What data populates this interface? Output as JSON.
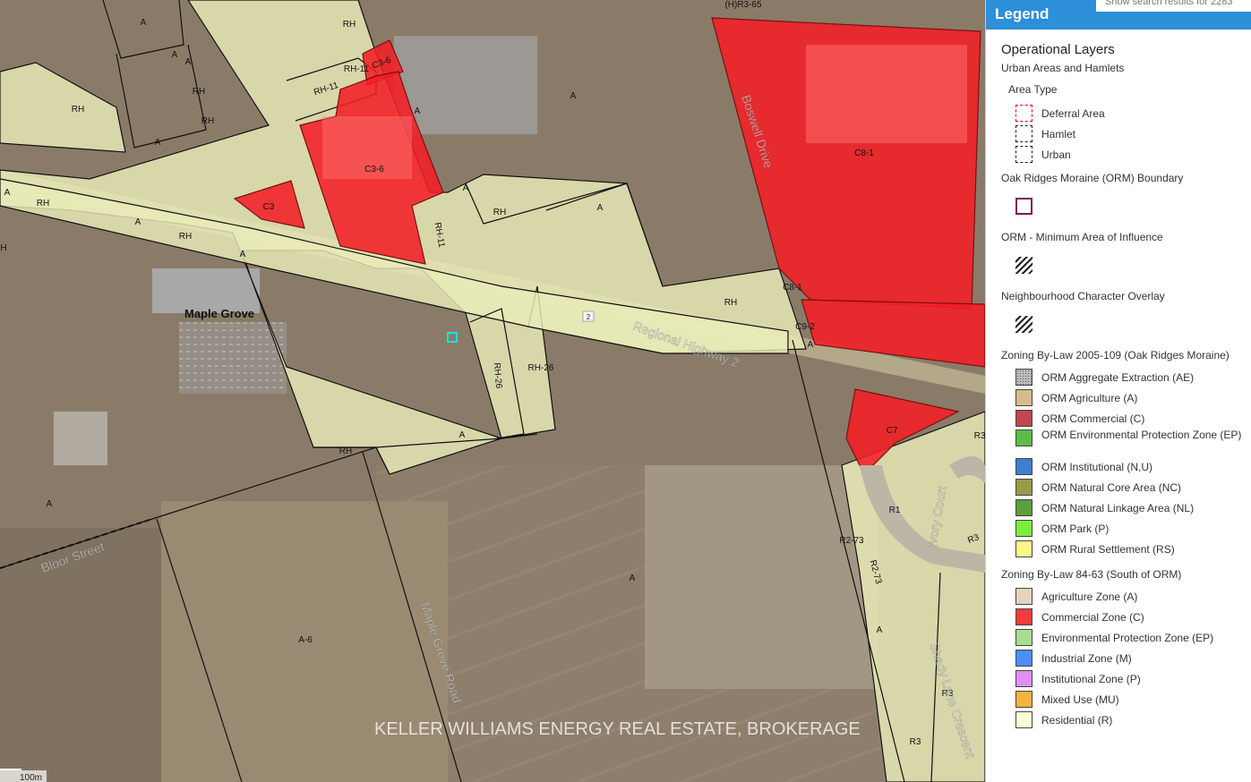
{
  "map": {
    "place_label": "Maple Grove",
    "streets": {
      "highway": "Regional Highway 2",
      "bloor": "Bloor Street",
      "maple_grove_road": "Maple Grove Road",
      "boswell": "Boswell Drive",
      "ivory": "Ivory Court",
      "shady_lane": "Shady Lane Crescent",
      "route_shield": "2"
    },
    "zone_labels": {
      "a_top_left": "A",
      "a_top_left2": "A",
      "a_top_left3": "A",
      "rh_top": "RH",
      "rh_left": "RH",
      "rh_left2": "RH",
      "rh_left3": "RH",
      "rh_11_a": "RH-11",
      "rh_11_b": "RH-11",
      "rh_11_c": "RH-11",
      "c3_6_top": "C3-6",
      "c3_6": "C3-6",
      "c3": "C3",
      "a_center": "A",
      "a_right": "A",
      "rh_right": "RH",
      "rh_mid": "RH",
      "a_small": "A",
      "rh_small": "RH",
      "rh_26": "RH-26",
      "rh_bot": "RH",
      "a_bot": "A",
      "a_left": "A",
      "a_left2": "A",
      "a_left3": "A",
      "a_field": "A",
      "a6": "A-6",
      "h": "H",
      "c8_1": "C8-1",
      "c8_1b": "C8-1",
      "c9_2": "C9-2",
      "a_corner": "A",
      "c7": "C7",
      "r1": "R1",
      "r3a": "R3",
      "r3b": "R3",
      "r3c": "R3",
      "r3d": "R3",
      "r2_73a": "R2-73",
      "r2_73b": "R2-73",
      "a_line": "A",
      "h_r3_65": "(H)R3-65"
    },
    "scale": "100m",
    "watermark": "KELLER WILLIAMS ENERGY REAL ESTATE, BROKERAGE"
  },
  "legend": {
    "title": "Legend",
    "search_hint": "Show search results for 2283",
    "operational_layers": "Operational Layers",
    "urban_areas": "Urban Areas and Hamlets",
    "area_type": "Area Type",
    "area_types": [
      "Deferral Area",
      "Hamlet",
      "Urban"
    ],
    "orm_boundary": "Oak Ridges Moraine (ORM) Boundary",
    "orm_min": "ORM - Minimum Area of Influence",
    "neighbourhood": "Neighbourhood Character Overlay",
    "zoning_orm": "Zoning By-Law 2005-109 (Oak Ridges Moraine)",
    "orm_items": [
      {
        "label": "ORM Aggregate Extraction (AE)",
        "color": "#9a9a9a"
      },
      {
        "label": "ORM Agriculture (A)",
        "color": "#d7b98c"
      },
      {
        "label": "ORM Commercial (C)",
        "color": "#c0474b"
      },
      {
        "label": "ORM Environmental Protection Zone (EP)",
        "color": "#5bbd45"
      },
      {
        "label": "ORM Institutional (N,U)",
        "color": "#3c7fcf"
      },
      {
        "label": "ORM Natural Core Area (NC)",
        "color": "#9a9a48"
      },
      {
        "label": "ORM Natural Linkage Area (NL)",
        "color": "#5c9f3c"
      },
      {
        "label": "ORM Park (P)",
        "color": "#7aef3a"
      },
      {
        "label": "ORM Rural Settlement (RS)",
        "color": "#f7f78a"
      }
    ],
    "zoning_south": "Zoning By-Law 84-63 (South of ORM)",
    "south_items": [
      {
        "label": "Agriculture Zone (A)",
        "color": "#e4d4c2"
      },
      {
        "label": "Commercial Zone (C)",
        "color": "#f23b3b"
      },
      {
        "label": "Environmental Protection Zone (EP)",
        "color": "#a9dd92"
      },
      {
        "label": "Industrial Zone (M)",
        "color": "#4a8ff5"
      },
      {
        "label": "Institutional Zone (P)",
        "color": "#e08ef0"
      },
      {
        "label": "Mixed Use (MU)",
        "color": "#f5b43e"
      },
      {
        "label": "Residential (R)",
        "color": "#fbfbd8"
      }
    ]
  }
}
